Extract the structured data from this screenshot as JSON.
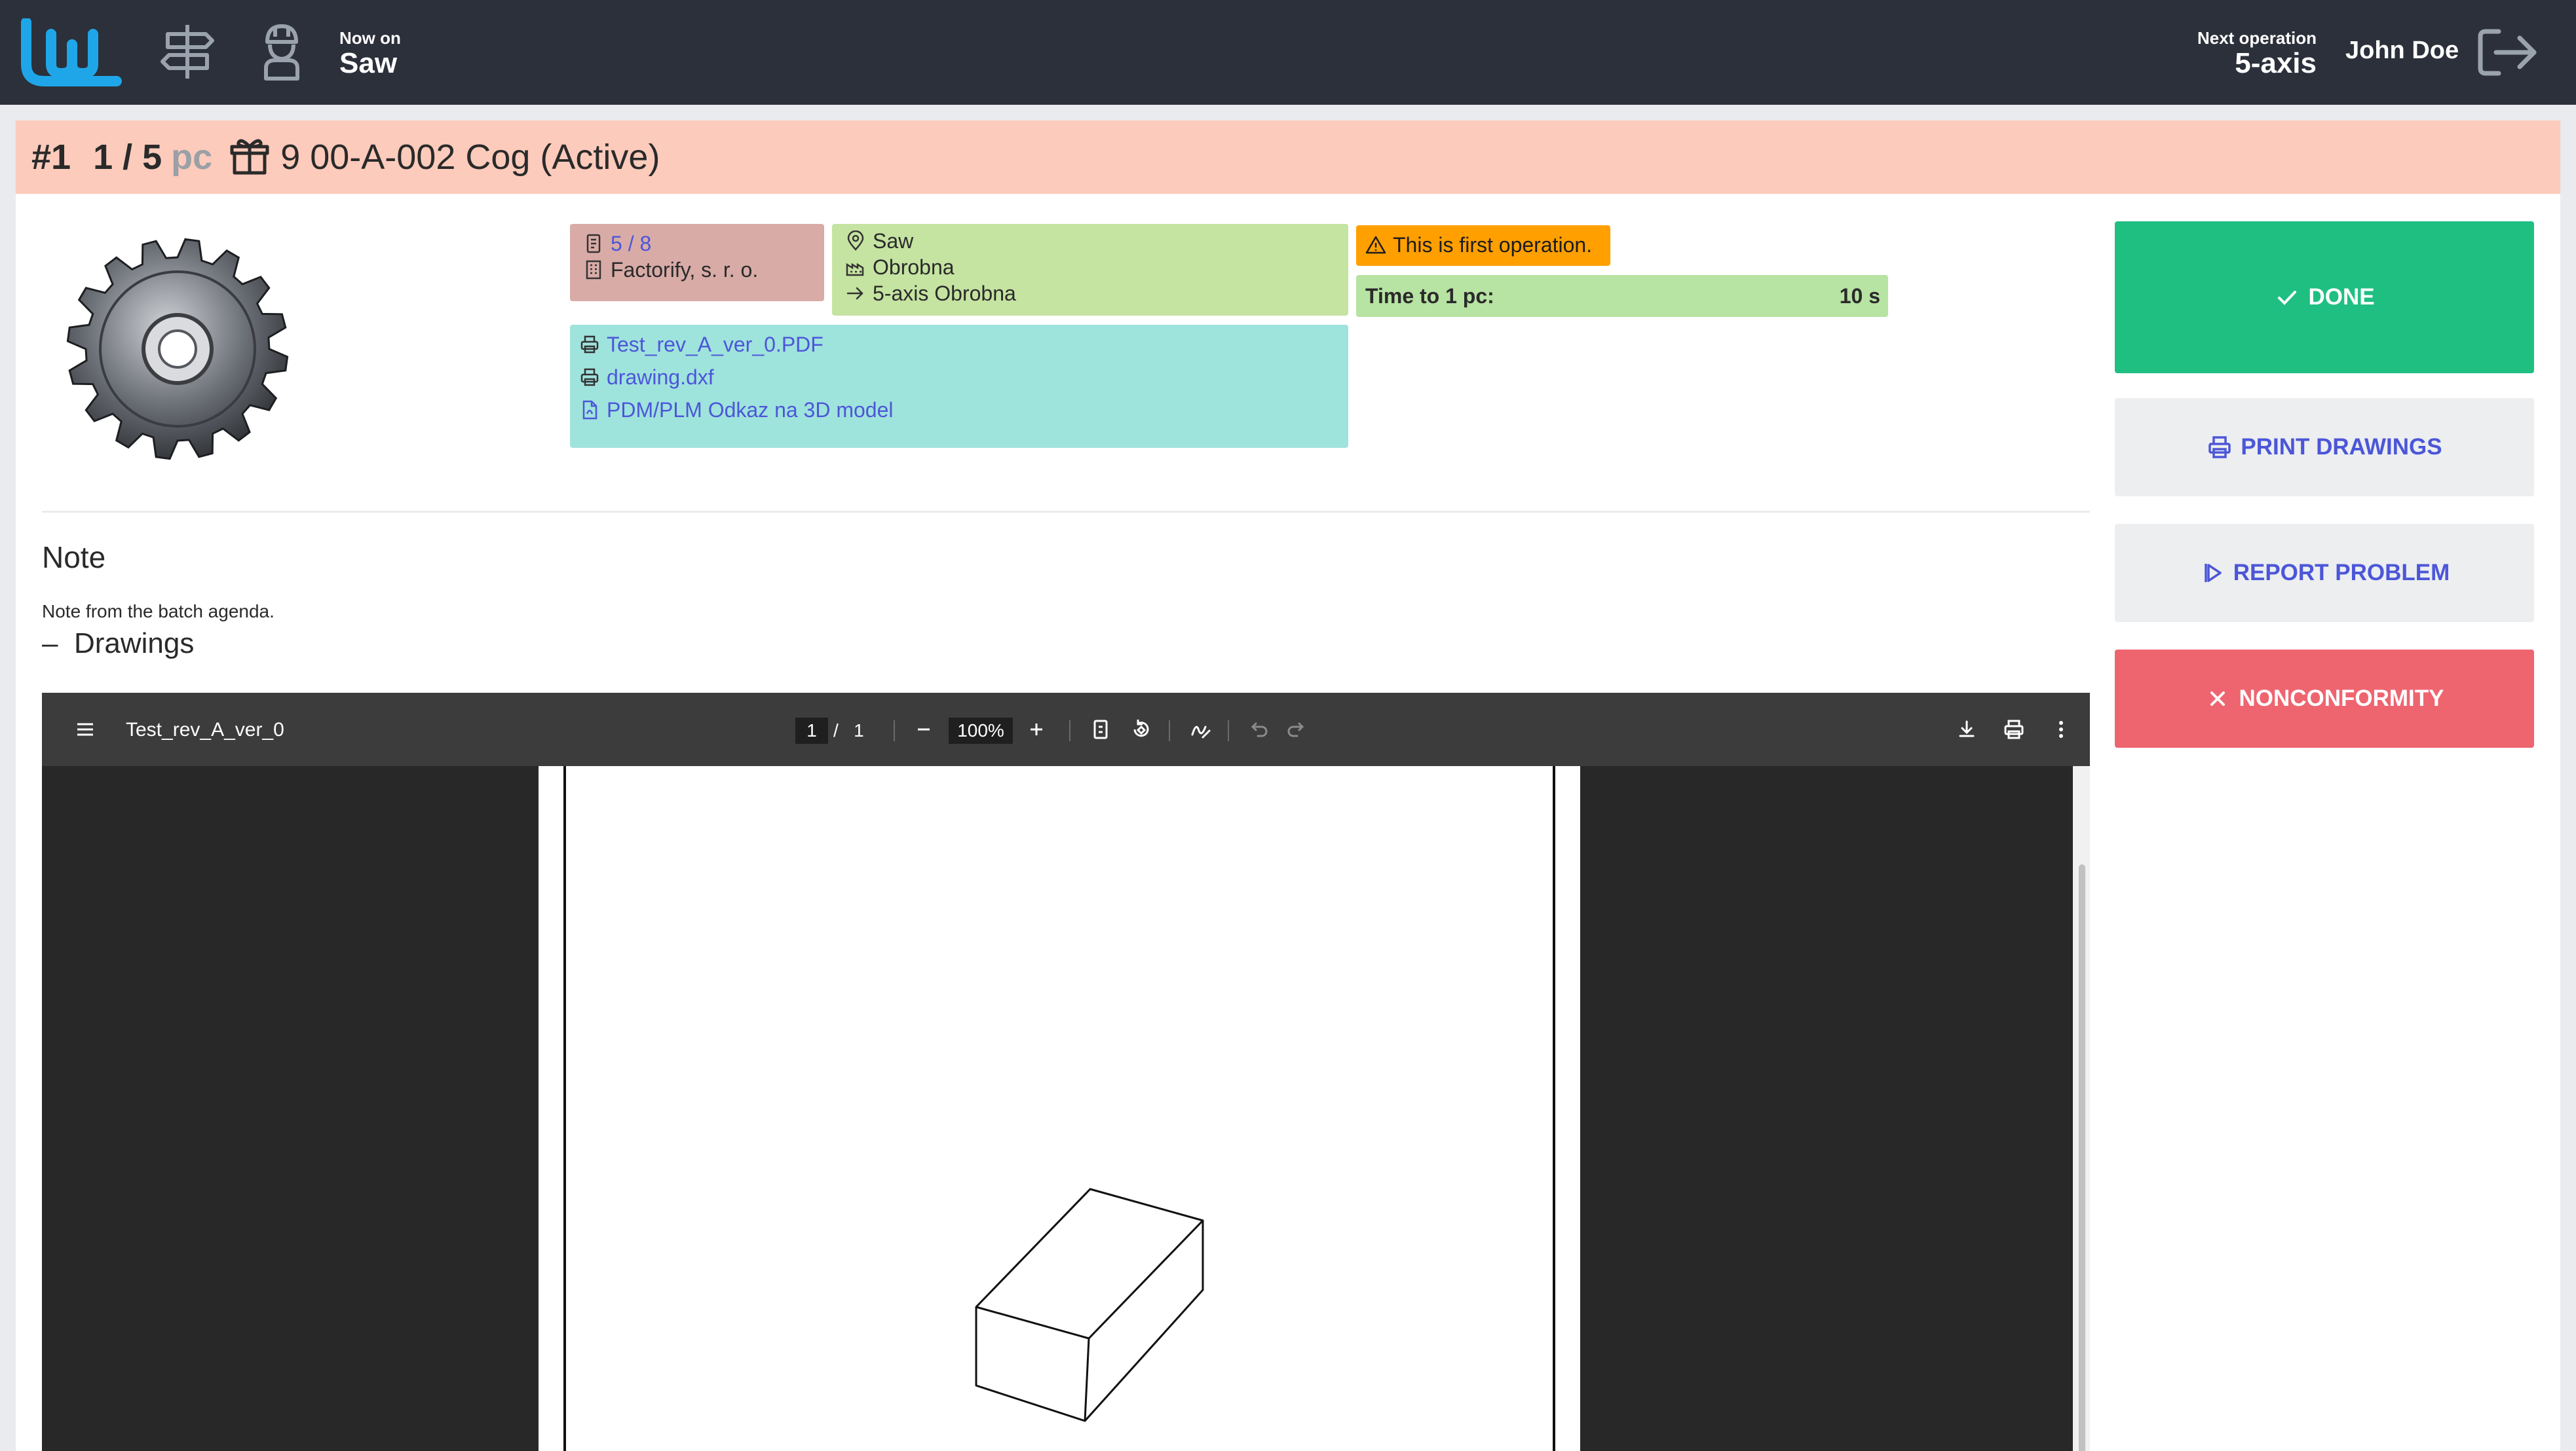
{
  "topbar": {
    "now_on_label": "Now on",
    "now_on_value": "Saw",
    "next_operation_label": "Next operation",
    "next_operation_value": "5-axis",
    "user_name": "John Doe",
    "icons": [
      "logo-icon",
      "signpost-icon",
      "worker-icon",
      "logout-icon"
    ]
  },
  "header": {
    "job_number": "#1",
    "quantity": "1 / 5",
    "unit": "pc",
    "part_title": "9 00-A-002 Cog (Active)",
    "background_color": "#fdcbbb"
  },
  "order_card": {
    "progress": "5 / 8",
    "company": "Factorify, s. r. o."
  },
  "place_card": {
    "workplace": "Saw",
    "department": "Obrobna",
    "next_label": "5-axis",
    "next_department": "Obrobna"
  },
  "warning": {
    "text": "This is first operation."
  },
  "time_card": {
    "label": "Time to 1 pc:",
    "value": "10 s"
  },
  "documents": [
    {
      "name": "Test_rev_A_ver_0.PDF",
      "icon": "printer-icon"
    },
    {
      "name": "drawing.dxf",
      "icon": "printer-icon"
    },
    {
      "name": "PDM/PLM Odkaz na 3D model",
      "icon": "file-icon"
    }
  ],
  "note": {
    "title": "Note",
    "text": "Note from the batch agenda.",
    "drawings_toggle": "–",
    "drawings_label": "Drawings"
  },
  "viewer": {
    "file_title": "Test_rev_A_ver_0",
    "page_current": "1",
    "page_separator": "/",
    "page_total": "1",
    "zoom": "100%"
  },
  "actions": {
    "done": "DONE",
    "print": "PRINT DRAWINGS",
    "report": "REPORT PROBLEM",
    "nonconformity": "NONCONFORMITY"
  },
  "colors": {
    "topbar": "#2c303a",
    "logo": "#1ea6e8",
    "done": "#1fbf82",
    "nonconformity": "#ee6570",
    "link": "#4c56d8",
    "warning": "#ff9f00"
  }
}
